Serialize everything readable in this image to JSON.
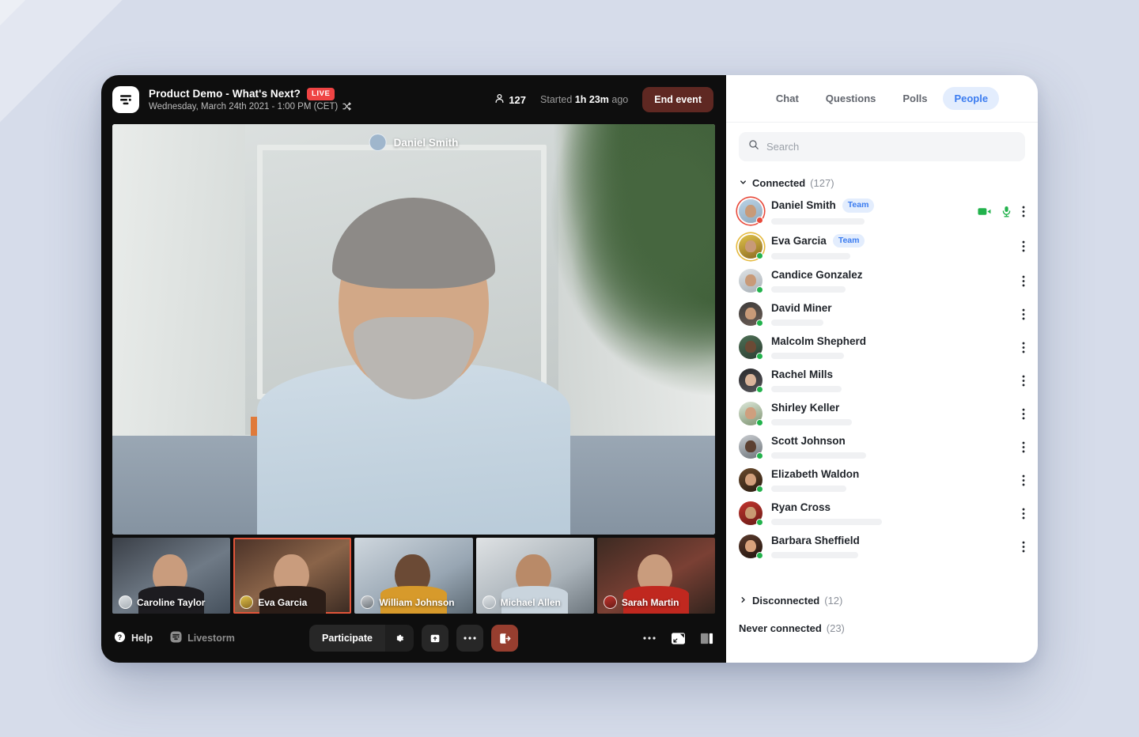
{
  "header": {
    "logo_icon": "livestorm-logo-icon",
    "event_title": "Product Demo - What's Next?",
    "live_badge": "LIVE",
    "event_datetime": "Wednesday, March 24th 2021 - 1:00 PM (CET)",
    "timezone_icon": "shuffle-icon",
    "attendee_icon": "person-icon",
    "attendee_count": "127",
    "started_prefix": "Started",
    "started_duration": "1h 23m",
    "started_suffix": "ago",
    "end_event_label": "End event",
    "end_event_color": "#5f2822"
  },
  "stage": {
    "main_speaker": "Daniel Smith",
    "thumbnails": [
      {
        "name": "Caroline Taylor",
        "active": false
      },
      {
        "name": "Eva Garcia",
        "active": true
      },
      {
        "name": "William Johnson",
        "active": false
      },
      {
        "name": "Michael Allen",
        "active": false
      },
      {
        "name": "Sarah Martin",
        "active": false
      }
    ]
  },
  "toolbar": {
    "help_icon": "question-circle-icon",
    "help_label": "Help",
    "brand_icon": "livestorm-small-icon",
    "brand_label": "Livestorm",
    "participate_label": "Participate",
    "participate_settings_icon": "gear-icon",
    "share_icon": "share-upload-icon",
    "more_icon": "ellipsis-icon",
    "leave_icon": "leave-door-icon",
    "leave_color": "#973e2f",
    "right_more_icon": "ellipsis-icon",
    "pip_icon": "picture-in-picture-icon",
    "layout_icon": "split-layout-icon"
  },
  "panel": {
    "tabs": [
      {
        "label": "Chat",
        "active": false
      },
      {
        "label": "Questions",
        "active": false
      },
      {
        "label": "Polls",
        "active": false
      },
      {
        "label": "People",
        "active": true
      }
    ],
    "active_tab_color": "#3b7cf0",
    "search": {
      "icon": "search-icon",
      "value": "",
      "placeholder": "Search"
    },
    "groups": [
      {
        "key": "connected",
        "label": "Connected",
        "count": "(127)",
        "chevron": "chevron-down-icon",
        "expanded": true
      },
      {
        "key": "disconnected",
        "label": "Disconnected",
        "count": "(12)",
        "chevron": "chevron-right-icon",
        "expanded": false
      },
      {
        "key": "never_connected",
        "label": "Never connected",
        "count": "(23)",
        "chevron": "",
        "expanded": false
      }
    ],
    "people": [
      {
        "name": "Daniel Smith",
        "badge": "Team",
        "status": "red",
        "ring": "ring-red",
        "avatar": "av-a",
        "bar": 118,
        "camera": true,
        "mic": true
      },
      {
        "name": "Eva Garcia",
        "badge": "Team",
        "status": "green",
        "ring": "ring-gold",
        "avatar": "av-b",
        "bar": 100,
        "camera": false,
        "mic": false
      },
      {
        "name": "Candice Gonzalez",
        "badge": "",
        "status": "green",
        "ring": "",
        "avatar": "av-c",
        "bar": 94,
        "camera": false,
        "mic": false
      },
      {
        "name": "David Miner",
        "badge": "",
        "status": "green",
        "ring": "",
        "avatar": "av-d",
        "bar": 66,
        "camera": false,
        "mic": false
      },
      {
        "name": "Malcolm Shepherd",
        "badge": "",
        "status": "green",
        "ring": "",
        "avatar": "av-e",
        "bar": 92,
        "camera": false,
        "mic": false
      },
      {
        "name": "Rachel Mills",
        "badge": "",
        "status": "green",
        "ring": "",
        "avatar": "av-f",
        "bar": 89,
        "camera": false,
        "mic": false
      },
      {
        "name": "Shirley Keller",
        "badge": "",
        "status": "green",
        "ring": "",
        "avatar": "av-g",
        "bar": 102,
        "camera": false,
        "mic": false
      },
      {
        "name": "Scott Johnson",
        "badge": "",
        "status": "green",
        "ring": "",
        "avatar": "av-h",
        "bar": 120,
        "camera": false,
        "mic": false
      },
      {
        "name": "Elizabeth Waldon",
        "badge": "",
        "status": "green",
        "ring": "",
        "avatar": "av-i",
        "bar": 95,
        "camera": false,
        "mic": false
      },
      {
        "name": "Ryan Cross",
        "badge": "",
        "status": "green",
        "ring": "",
        "avatar": "av-j",
        "bar": 140,
        "camera": false,
        "mic": false
      },
      {
        "name": "Barbara Sheffield",
        "badge": "",
        "status": "green",
        "ring": "",
        "avatar": "av-k",
        "bar": 110,
        "camera": false,
        "mic": false
      }
    ],
    "kebab_icon": "kebab-menu-icon",
    "camera_icon": "video-camera-icon",
    "mic_icon": "microphone-icon"
  }
}
